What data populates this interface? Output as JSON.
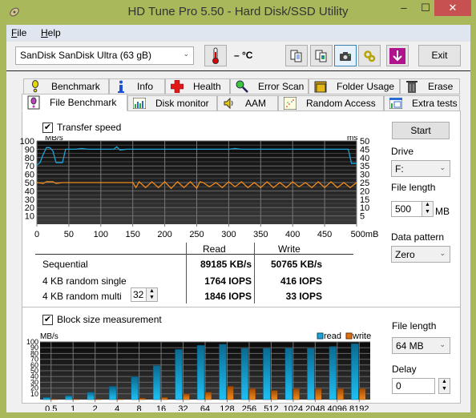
{
  "window": {
    "title": "HD Tune Pro 5.50 - Hard Disk/SSD Utility",
    "controls": {
      "minimize": "–",
      "maximize": "☐",
      "close": "✕"
    }
  },
  "menu": {
    "items": [
      {
        "label": "File",
        "accel": "F",
        "rest": "ile"
      },
      {
        "label": "Help",
        "accel": "H",
        "rest": "elp"
      }
    ]
  },
  "toolbar": {
    "drive": "SanDisk SanDisk Ultra (63 gB)",
    "temperature": "– °C",
    "buttons": [
      "copy-text-icon",
      "copy-screenshot-icon",
      "camera-icon",
      "options-icon",
      "save-download-icon"
    ],
    "exit_label": "Exit"
  },
  "tabs": {
    "row1": [
      {
        "label": "Benchmark",
        "icon": "benchmark-icon"
      },
      {
        "label": "Info",
        "icon": "info-icon"
      },
      {
        "label": "Health",
        "icon": "health-cross-icon"
      },
      {
        "label": "Error Scan",
        "icon": "magnifier-icon"
      },
      {
        "label": "Folder Usage",
        "icon": "folder-icon"
      },
      {
        "label": "Erase",
        "icon": "trash-icon"
      }
    ],
    "row2": [
      {
        "label": "File Benchmark",
        "icon": "file-benchmark-icon",
        "selected": true
      },
      {
        "label": "Disk monitor",
        "icon": "disk-monitor-icon"
      },
      {
        "label": "AAM",
        "icon": "speaker-icon"
      },
      {
        "label": "Random Access",
        "icon": "random-access-icon"
      },
      {
        "label": "Extra tests",
        "icon": "extra-tests-icon"
      }
    ]
  },
  "transfer": {
    "checkbox_label": "Transfer speed",
    "checked": true
  },
  "results": {
    "col_read": "Read",
    "col_write": "Write",
    "rows": [
      {
        "label": "Sequential",
        "read": "89185 KB/s",
        "write": "50765 KB/s"
      },
      {
        "label": "4 KB random single",
        "read": "1764 IOPS",
        "write": "416 IOPS"
      },
      {
        "label": "4 KB random multi",
        "read": "1846 IOPS",
        "write": "33 IOPS",
        "queue_depth": "32"
      }
    ]
  },
  "side": {
    "start_label": "Start",
    "drive_label": "Drive",
    "drive_value": "F:",
    "file_length_label": "File length",
    "file_length_value": "500",
    "file_length_unit": "MB",
    "data_pattern_label": "Data pattern",
    "data_pattern_value": "Zero"
  },
  "block": {
    "checkbox_label": "Block size measurement",
    "checked": true,
    "file_length_label": "File length",
    "file_length_value": "64 MB",
    "delay_label": "Delay",
    "delay_value": "0"
  },
  "chart_data": [
    {
      "type": "line",
      "title": "Transfer speed",
      "ylabel": "MB/s",
      "y2label": "ms",
      "xlabel": "mB",
      "xlim": [
        0,
        500
      ],
      "ylim": [
        0,
        100
      ],
      "y2lim": [
        0,
        50
      ],
      "x_ticks": [
        0,
        50,
        100,
        150,
        200,
        250,
        300,
        350,
        400,
        450,
        500
      ],
      "x_tick_labels": [
        "0",
        "50",
        "100",
        "150",
        "200",
        "250",
        "300",
        "350",
        "400",
        "450",
        "500mB"
      ],
      "y_ticks": [
        10,
        20,
        30,
        40,
        50,
        60,
        70,
        80,
        90,
        100
      ],
      "y2_ticks": [
        5,
        10,
        15,
        20,
        25,
        30,
        35,
        40,
        45,
        50
      ],
      "grid": true,
      "series": [
        {
          "name": "read",
          "color": "#1aa3d9",
          "x": [
            0,
            5,
            10,
            15,
            20,
            25,
            30,
            40,
            45,
            50,
            60,
            70,
            80,
            100,
            120,
            125,
            130,
            140,
            160,
            180,
            200,
            220,
            240,
            260,
            280,
            300,
            310,
            320,
            350,
            400,
            450,
            480,
            487,
            492,
            500
          ],
          "values": [
            71,
            74,
            84,
            92,
            92,
            88,
            74,
            74,
            90,
            90,
            90,
            91,
            90,
            90,
            90,
            93,
            89,
            90,
            90,
            90,
            90,
            90,
            90,
            90,
            90,
            90,
            91,
            90,
            90,
            90,
            90,
            90,
            90,
            73,
            73
          ]
        },
        {
          "name": "write",
          "color": "#f08a1c",
          "x": [
            0,
            10,
            15,
            25,
            30,
            40,
            50,
            75,
            100,
            125,
            150,
            155,
            160,
            170,
            180,
            190,
            200,
            210,
            220,
            230,
            240,
            250,
            255,
            260,
            270,
            280,
            290,
            300,
            310,
            320,
            330,
            340,
            350,
            360,
            370,
            380,
            390,
            400,
            410,
            420,
            430,
            440,
            450,
            460,
            470,
            480,
            490,
            500
          ],
          "values": [
            50,
            49,
            51,
            51,
            49,
            50,
            50,
            50,
            50,
            50,
            50,
            44,
            51,
            44,
            51,
            44,
            51,
            43,
            51,
            44,
            51,
            43,
            51,
            50,
            45,
            50,
            44,
            51,
            45,
            51,
            44,
            50,
            44,
            51,
            44,
            50,
            44,
            51,
            45,
            50,
            44,
            51,
            44,
            51,
            44,
            50,
            44,
            50
          ]
        }
      ]
    },
    {
      "type": "bar",
      "title": "Block size measurement",
      "ylabel": "MB/s",
      "ylim": [
        0,
        100
      ],
      "y_ticks": [
        10,
        20,
        30,
        40,
        50,
        60,
        70,
        80,
        90,
        100
      ],
      "grid": true,
      "legend": "top-right",
      "categories": [
        "0.5",
        "1",
        "2",
        "4",
        "8",
        "16",
        "32",
        "64",
        "128",
        "256",
        "512",
        "1024",
        "2048",
        "4096",
        "8192"
      ],
      "series": [
        {
          "name": "read",
          "color": "#1aa3d9",
          "values": [
            4,
            7,
            13,
            23,
            40,
            59,
            87,
            94,
            96,
            89,
            89,
            89,
            89,
            92,
            97
          ]
        },
        {
          "name": "write",
          "color": "#e0700f",
          "values": [
            1,
            1,
            1,
            1,
            2.5,
            4,
            10,
            13,
            23,
            19,
            16,
            19,
            19,
            19,
            19
          ]
        }
      ]
    }
  ]
}
